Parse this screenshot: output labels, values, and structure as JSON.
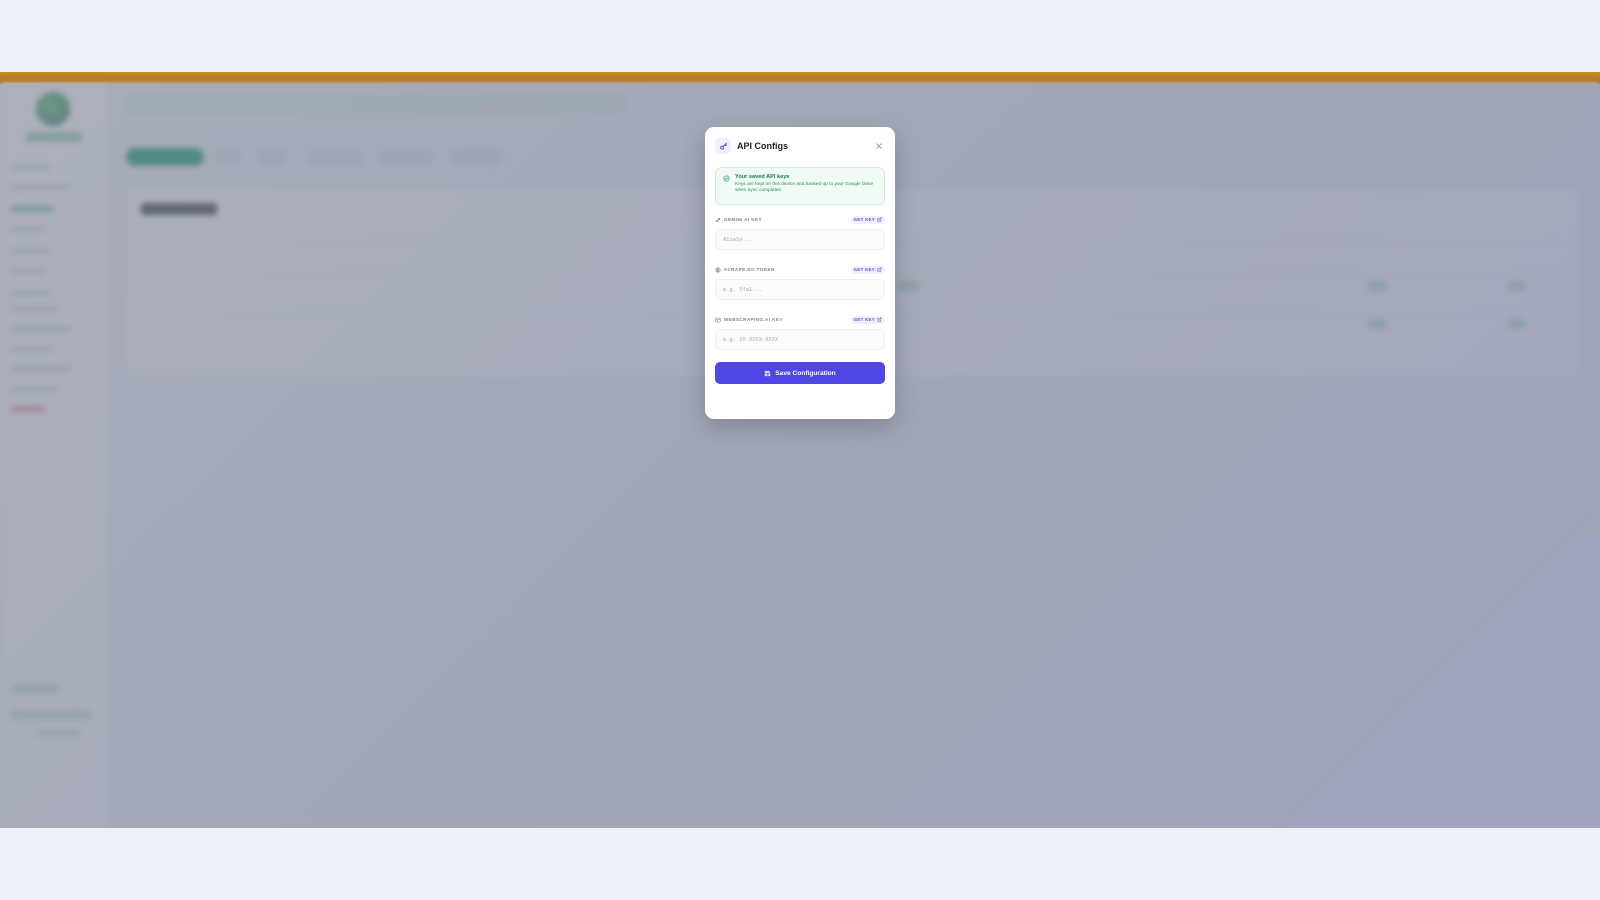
{
  "modal": {
    "title": "API Configs",
    "close_icon": "close-icon",
    "header_icon": "key-icon"
  },
  "notice": {
    "title": "Your saved API keys",
    "body": "Keys are kept on this device and backed up to your Google Drive when sync completes.",
    "icon": "shield-check-icon"
  },
  "fields": [
    {
      "label": "GEMINI AI KEY",
      "icon": "link-icon",
      "get_key": "GET KEY",
      "placeholder": "AIzaSy..."
    },
    {
      "label": "SCRAPE.DO TOKEN",
      "icon": "globe-icon",
      "get_key": "GET KEY",
      "placeholder": "e.g. 5fa1..."
    },
    {
      "label": "WEBSCRAPING.AI KEY",
      "icon": "layout-icon",
      "get_key": "GET KEY",
      "placeholder": "e.g. XX-XXXX-XXXX"
    }
  ],
  "save_button": {
    "label": "Save Configuration",
    "icon": "save-icon"
  },
  "colors": {
    "accent": "#4f46e5",
    "notice_bg": "#effbf4",
    "notice_text": "#157a4b",
    "top_accent": "#c98a1a"
  }
}
